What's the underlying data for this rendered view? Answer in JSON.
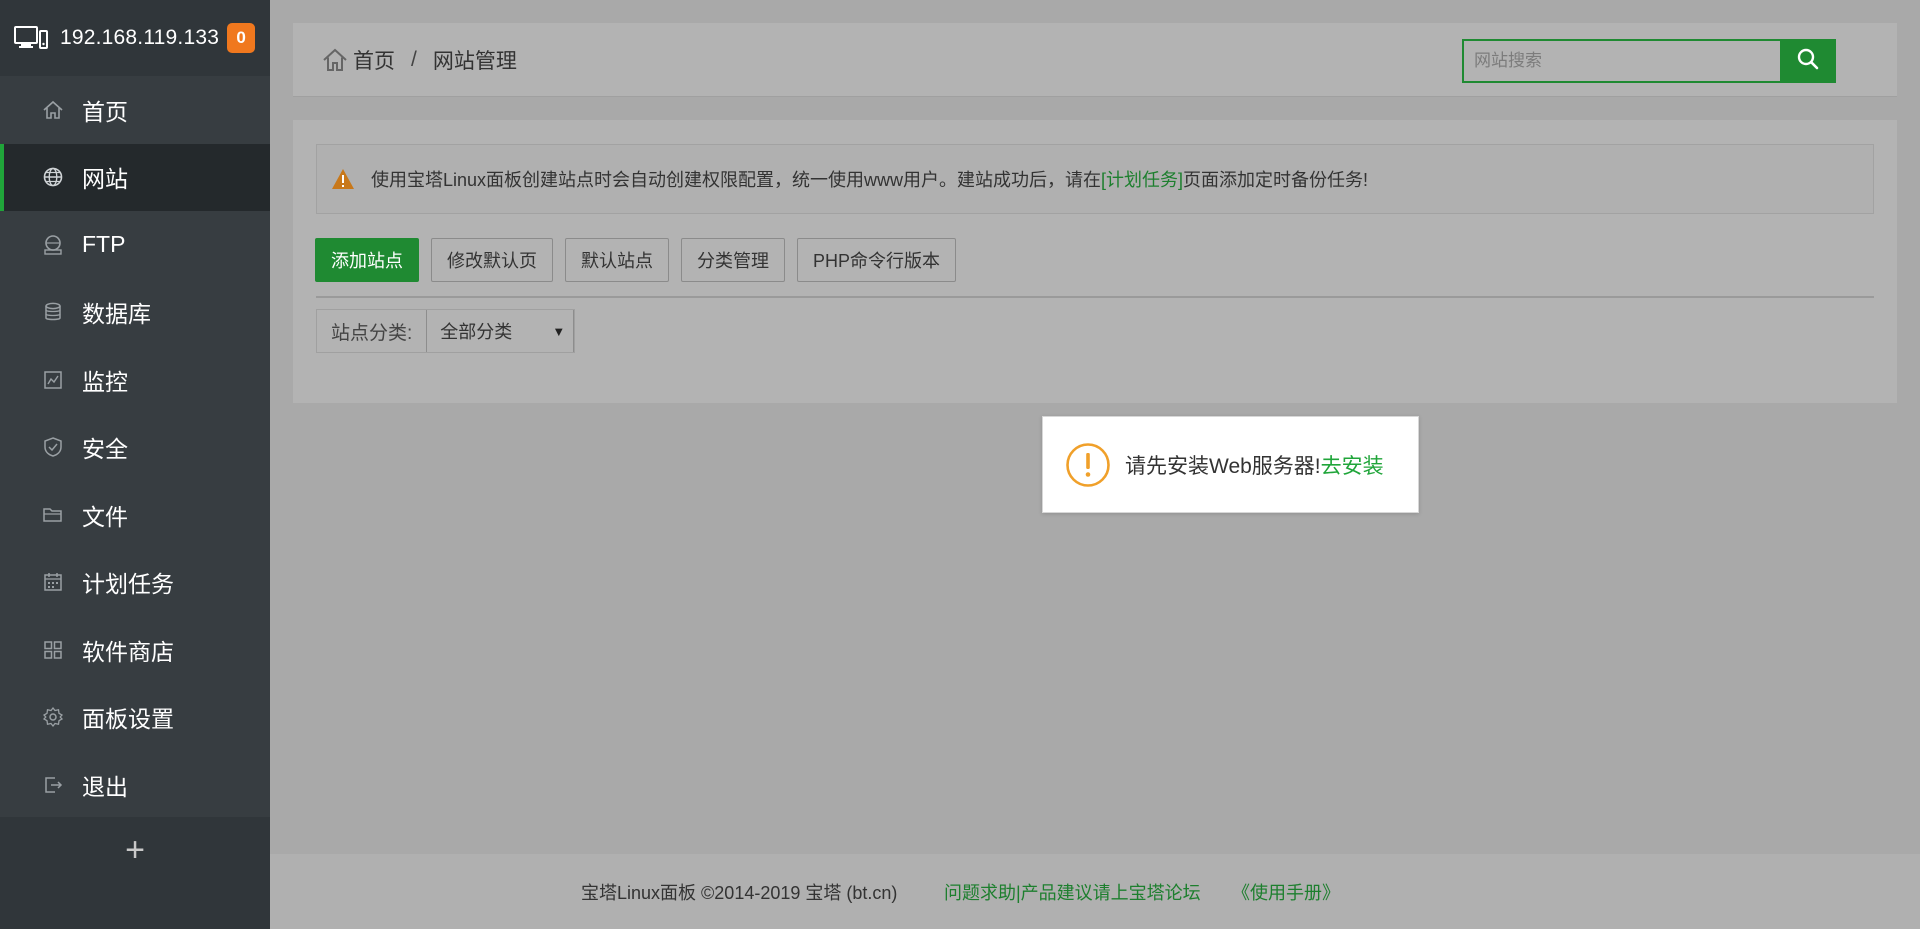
{
  "colors": {
    "accent": "#20a53a",
    "badge": "#f0781e",
    "sidebar_bg": "#373d41"
  },
  "sidebar": {
    "host_ip": "192.168.119.133",
    "badge_count": "0",
    "items": [
      {
        "label": "首页",
        "icon": "home-icon"
      },
      {
        "label": "网站",
        "icon": "globe-icon",
        "active": true
      },
      {
        "label": "FTP",
        "icon": "ftp-icon"
      },
      {
        "label": "数据库",
        "icon": "database-icon"
      },
      {
        "label": "监控",
        "icon": "monitor-icon"
      },
      {
        "label": "安全",
        "icon": "shield-icon"
      },
      {
        "label": "文件",
        "icon": "folder-icon"
      },
      {
        "label": "计划任务",
        "icon": "calendar-icon"
      },
      {
        "label": "软件商店",
        "icon": "grid-icon"
      },
      {
        "label": "面板设置",
        "icon": "gear-icon"
      },
      {
        "label": "退出",
        "icon": "logout-icon"
      }
    ],
    "add_label": "+"
  },
  "header": {
    "breadcrumb": {
      "home": "首页",
      "separator": "/",
      "current": "网站管理"
    },
    "search_placeholder": "网站搜索"
  },
  "notice": {
    "text_before": "使用宝塔Linux面板创建站点时会自动创建权限配置，统一使用www用户。建站成功后，请在",
    "link": "[计划任务]",
    "text_after": "页面添加定时备份任务!"
  },
  "toolbar": {
    "add_site": "添加站点",
    "edit_default_page": "修改默认页",
    "default_site": "默认站点",
    "category_manage": "分类管理",
    "php_cli_version": "PHP命令行版本"
  },
  "filter": {
    "label": "站点分类:",
    "selected": "全部分类"
  },
  "toast": {
    "message": "请先安装Web服务器!",
    "action": "去安装"
  },
  "footer": {
    "copyright": "宝塔Linux面板 ©2014-2019 宝塔 (bt.cn)",
    "help": "问题求助|产品建议请上宝塔论坛",
    "manual": "《使用手册》"
  }
}
